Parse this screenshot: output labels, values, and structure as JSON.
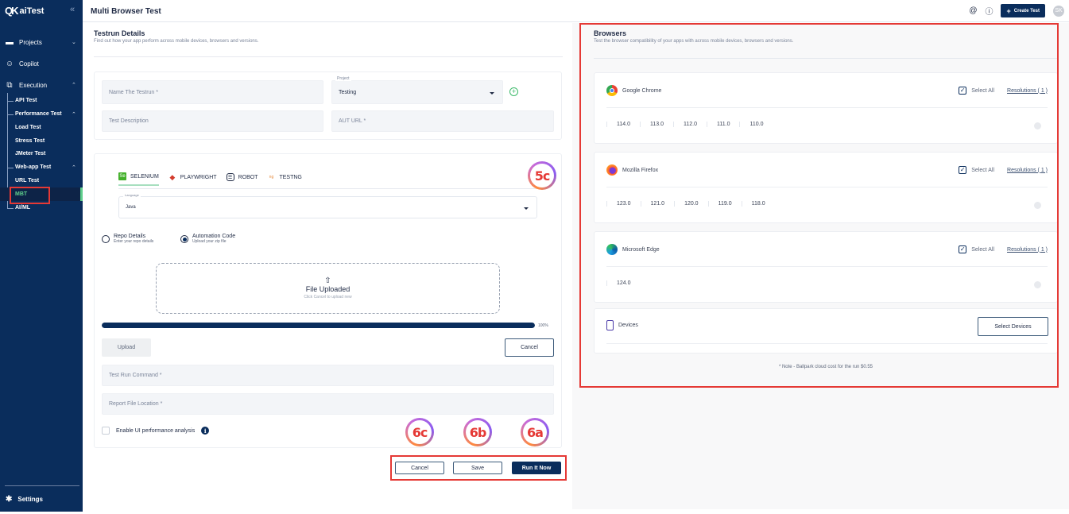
{
  "sidebar": {
    "brand": "aiTest",
    "collapse_icon": "double-chevron-left",
    "items": [
      {
        "label": "Projects",
        "icon": "folder-icon"
      },
      {
        "label": "Copilot",
        "icon": "copilot-icon"
      },
      {
        "label": "Execution",
        "icon": "external-edit-icon"
      }
    ],
    "execution_children": [
      "API Test",
      "Performance Test",
      "Web-app Test",
      "AI/ML"
    ],
    "performance_children": [
      "Load Test",
      "Stress Test",
      "JMeter Test"
    ],
    "webapp_children": [
      "URL Test",
      "MBT"
    ],
    "active_item": "MBT",
    "settings_label": "Settings",
    "active_color": "#5fce8c"
  },
  "header": {
    "title": "Multi Browser Test",
    "create_button": "Create Test",
    "avatar_initials": "SK"
  },
  "testrun": {
    "title": "Testrun Details",
    "subtitle": "Find out how your app perform across mobile devices, browsers and versions.",
    "name_placeholder": "Name The Testrun *",
    "project_label": "Project",
    "project_value": "Testing",
    "description_placeholder": "Test Description",
    "aut_url_placeholder": "AUT URL *"
  },
  "framework": {
    "tabs": [
      {
        "label": "SELENIUM",
        "icon": "selenium-icon",
        "active": true
      },
      {
        "label": "PLAYWRIGHT",
        "icon": "playwright-icon",
        "active": false
      },
      {
        "label": "ROBOT",
        "icon": "robot-icon",
        "active": false
      },
      {
        "label": "TESTNG",
        "icon": "testng-icon",
        "active": false
      }
    ],
    "language_label": "Language",
    "language_value": "Java",
    "source_options": [
      {
        "title": "Repo Details",
        "subtitle": "Enter your repo details",
        "selected": false
      },
      {
        "title": "Automation Code",
        "subtitle": "Upload your zip file",
        "selected": true
      }
    ],
    "dropzone_title": "File Uploaded",
    "dropzone_subtitle": "Click Cancel to upload new",
    "progress_percent": 100,
    "progress_label": "100%",
    "upload_button": "Upload",
    "cancel_button": "Cancel",
    "run_command_placeholder": "Test Run Command *",
    "report_location_placeholder": "Report File Location *",
    "perf_checkbox_label": "Enable UI performance analysis",
    "perf_checkbox_checked": false
  },
  "annotations": {
    "badge_5c": "5c",
    "badge_6c": "6c",
    "badge_6b": "6b",
    "badge_6a": "6a",
    "highlight_color": "#e53935"
  },
  "actions": {
    "cancel": "Cancel",
    "save": "Save",
    "run": "Run It Now"
  },
  "browsers": {
    "title": "Browsers",
    "subtitle": "Test the browser compatibility of your apps with across mobile devices, browsers and versions.",
    "select_all_label": "Select All",
    "list": [
      {
        "name": "Google Chrome",
        "icon": "chrome-icon",
        "select_all": true,
        "resolutions": "Resolutions ( 1 )",
        "versions": [
          "114.0",
          "113.0",
          "112.0",
          "111.0",
          "110.0"
        ]
      },
      {
        "name": "Mozilla Firefox",
        "icon": "firefox-icon",
        "select_all": true,
        "resolutions": "Resolutions ( 1 )",
        "versions": [
          "123.0",
          "121.0",
          "120.0",
          "119.0",
          "118.0"
        ]
      },
      {
        "name": "Microsoft Edge",
        "icon": "edge-icon",
        "select_all": true,
        "resolutions": "Resolutions ( 1 )",
        "versions": [
          "124.0"
        ]
      }
    ],
    "devices_label": "Devices",
    "select_devices_button": "Select Devices",
    "note": "* Note - Ballpark cloud cost for the run $0.55"
  }
}
